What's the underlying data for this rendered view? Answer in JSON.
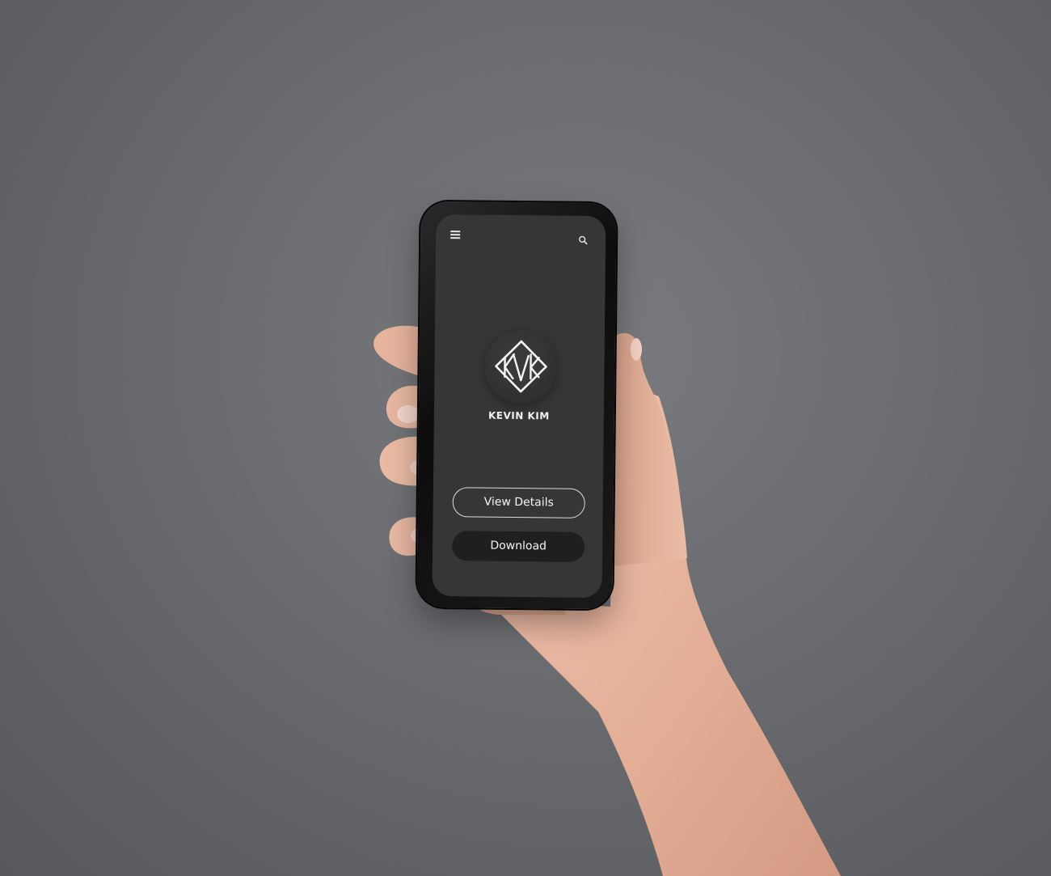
{
  "app": {
    "header": {
      "menu_icon": "hamburger-menu-icon",
      "search_icon": "search-icon"
    },
    "profile": {
      "logo_text": "KVK",
      "name": "KEVIN KIM"
    },
    "actions": {
      "view_details_label": "View Details",
      "download_label": "Download"
    }
  },
  "colors": {
    "background": "#6b6d71",
    "screen": "#363637",
    "button_solid": "#1f1f20",
    "text": "#f2f2f2",
    "skin": "#e9b9a3"
  }
}
